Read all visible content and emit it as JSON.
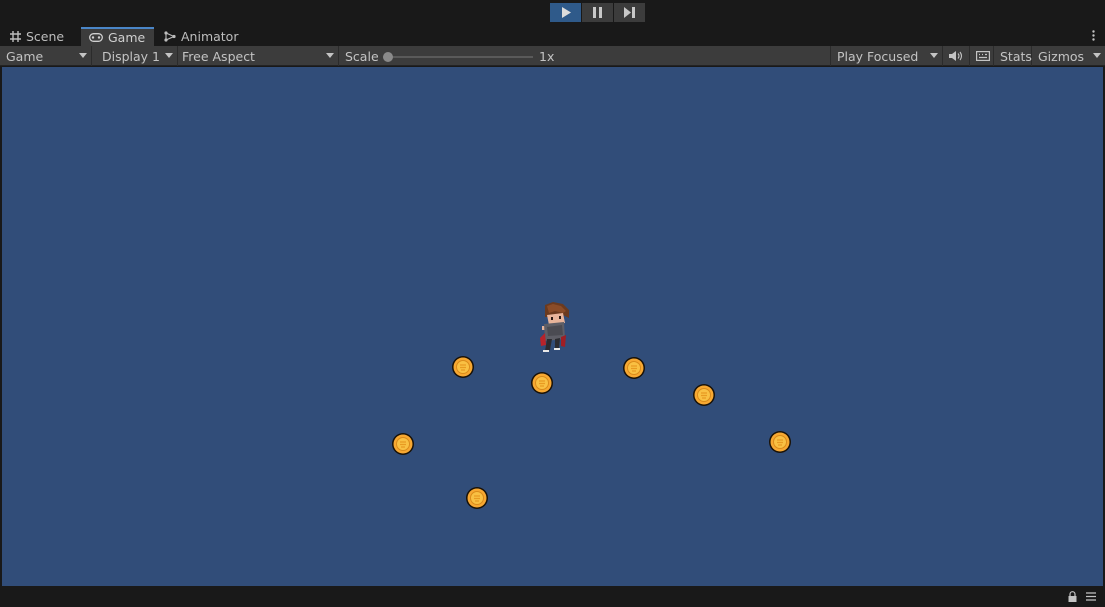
{
  "playbar": {
    "buttons": [
      {
        "name": "play",
        "icon": "play-icon",
        "active": true
      },
      {
        "name": "pause",
        "icon": "pause-icon",
        "active": false
      },
      {
        "name": "step",
        "icon": "step-icon",
        "active": false
      }
    ]
  },
  "tabs": [
    {
      "label": "Scene",
      "icon": "grid-icon",
      "active": false
    },
    {
      "label": "Game",
      "icon": "gamepad-icon",
      "active": true
    },
    {
      "label": "Animator",
      "icon": "animator-icon",
      "active": false
    }
  ],
  "toolbar": {
    "view_mode": "Game",
    "display": "Display 1",
    "aspect": "Free Aspect",
    "scale_label": "Scale",
    "scale_value": "1x",
    "scale_fraction": 0.0,
    "play_mode": "Play Focused",
    "stats_label": "Stats",
    "gizmos_label": "Gizmos"
  },
  "colors": {
    "viewport_background": "#314d79",
    "play_active": "#2f5a8a",
    "coin_fill": "#f7a832",
    "coin_outline": "#1a1207"
  },
  "scene": {
    "player": {
      "sprite": "player-character"
    },
    "coins": [
      {
        "id": "coin-1"
      },
      {
        "id": "coin-2"
      },
      {
        "id": "coin-3"
      },
      {
        "id": "coin-4"
      },
      {
        "id": "coin-5"
      },
      {
        "id": "coin-6"
      },
      {
        "id": "coin-7"
      }
    ]
  },
  "statusbar": {
    "icons": [
      "lock-icon",
      "menu-icon"
    ]
  }
}
